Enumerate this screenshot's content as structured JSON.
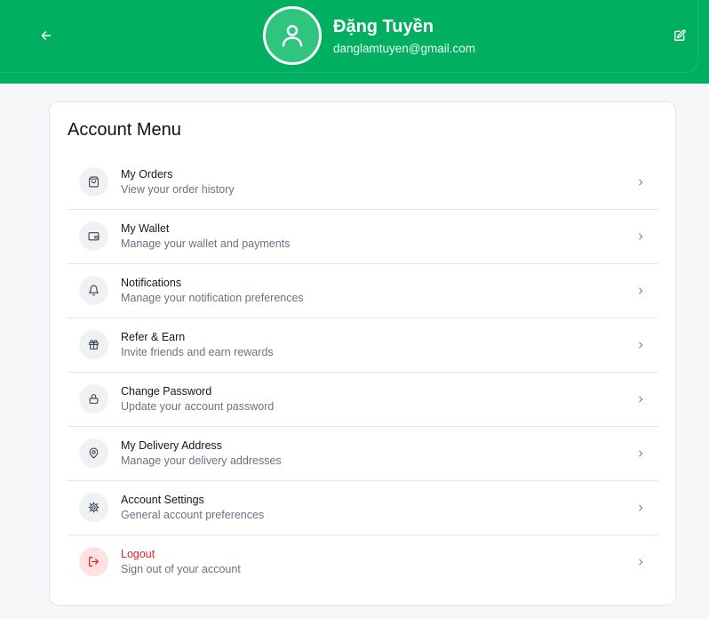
{
  "header": {
    "back_icon": "arrow-left-icon",
    "edit_icon": "edit-icon",
    "avatar_icon": "user-icon",
    "name": "Đặng Tuyền",
    "email": "danglamtuyen@gmail.com",
    "brand_color": "#00b060"
  },
  "card": {
    "title": "Account Menu"
  },
  "menu": {
    "items": [
      {
        "title": "My Orders",
        "subtitle": "View your order history",
        "icon": "shopping-bag-icon"
      },
      {
        "title": "My Wallet",
        "subtitle": "Manage your wallet and payments",
        "icon": "wallet-icon"
      },
      {
        "title": "Notifications",
        "subtitle": "Manage your notification preferences",
        "icon": "bell-icon"
      },
      {
        "title": "Refer & Earn",
        "subtitle": "Invite friends and earn rewards",
        "icon": "gift-icon"
      },
      {
        "title": "Change Password",
        "subtitle": "Update your account password",
        "icon": "lock-icon"
      },
      {
        "title": "My Delivery Address",
        "subtitle": "Manage your delivery addresses",
        "icon": "map-pin-icon"
      },
      {
        "title": "Account Settings",
        "subtitle": "General account preferences",
        "icon": "settings-icon"
      },
      {
        "title": "Logout",
        "subtitle": "Sign out of your account",
        "icon": "logout-icon",
        "danger_color": "#dc2626"
      }
    ]
  }
}
